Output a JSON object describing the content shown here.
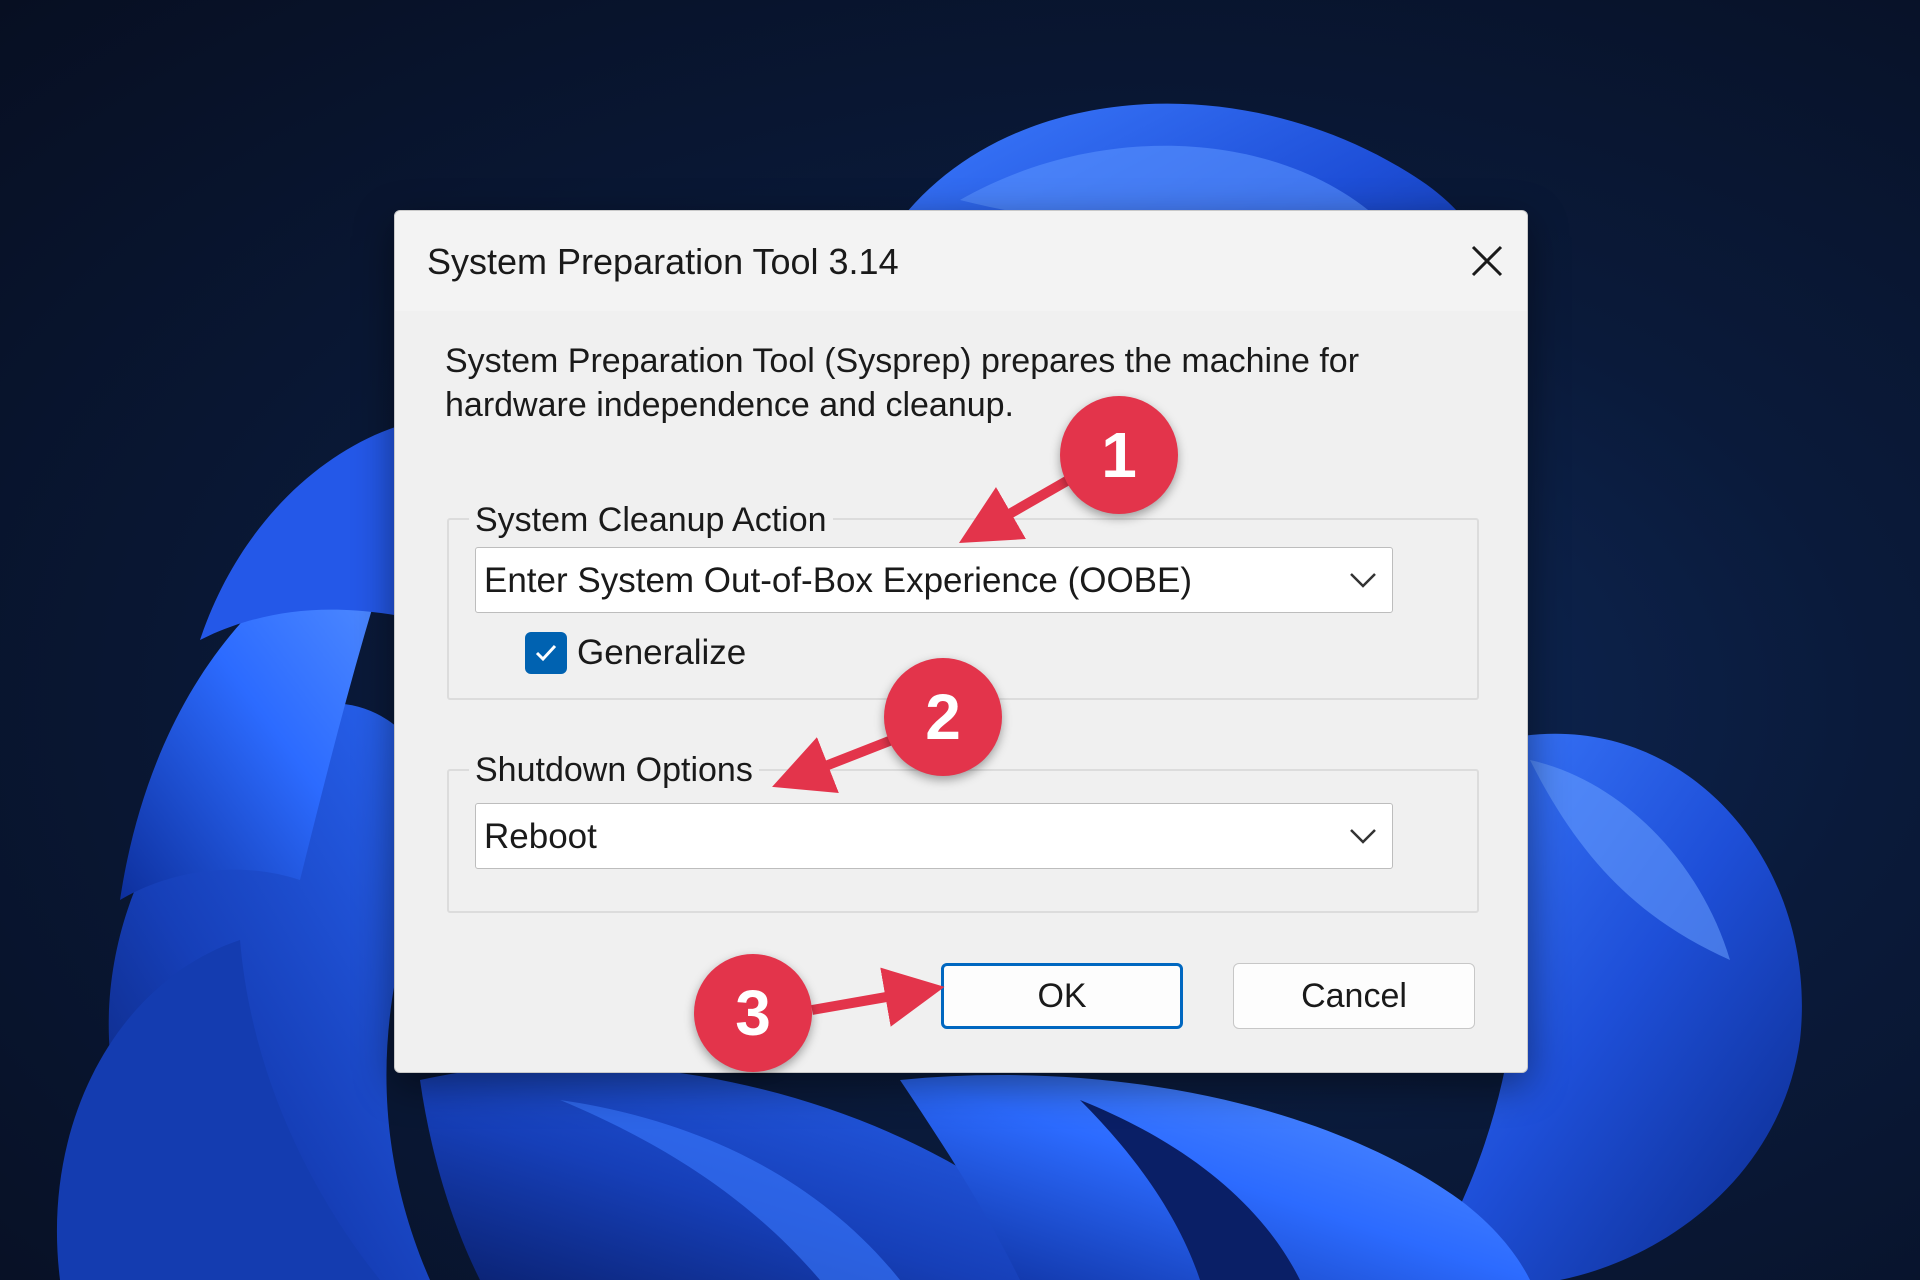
{
  "dialog": {
    "title": "System Preparation Tool 3.14",
    "description": "System Preparation Tool (Sysprep) prepares the machine for hardware independence and cleanup."
  },
  "cleanup_group": {
    "label": "System Cleanup Action",
    "selected": "Enter System Out-of-Box Experience (OOBE)",
    "generalize_label": "Generalize",
    "generalize_checked": true
  },
  "shutdown_group": {
    "label": "Shutdown Options",
    "selected": "Reboot"
  },
  "buttons": {
    "ok_label": "OK",
    "cancel_label": "Cancel"
  },
  "annotations": {
    "step1": "1",
    "step2": "2",
    "step3": "3"
  },
  "colors": {
    "accent": "#0067c0",
    "checkbox_fill": "#0062b1",
    "annotation_red": "#e3344b",
    "wallpaper_blue": "#1e4fd8"
  },
  "icons": {
    "close": "close-icon",
    "dropdown": "chevron-down-icon",
    "check": "checkmark-icon"
  }
}
